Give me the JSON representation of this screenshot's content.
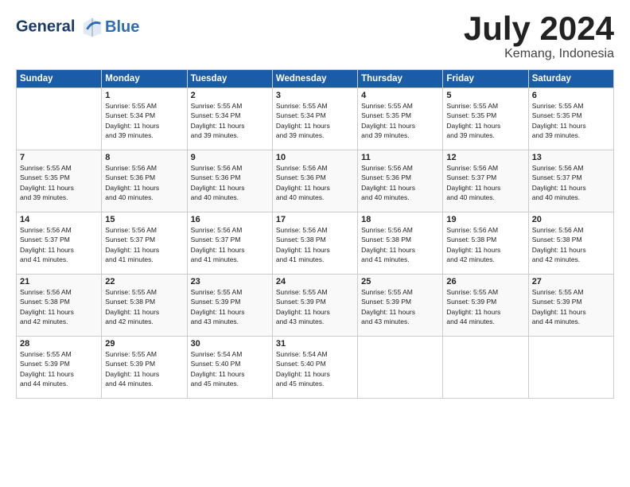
{
  "header": {
    "logo_line1": "General",
    "logo_line2": "Blue",
    "title": "July 2024",
    "subtitle": "Kemang, Indonesia"
  },
  "days_of_week": [
    "Sunday",
    "Monday",
    "Tuesday",
    "Wednesday",
    "Thursday",
    "Friday",
    "Saturday"
  ],
  "weeks": [
    [
      {
        "day": "",
        "info": ""
      },
      {
        "day": "1",
        "info": "Sunrise: 5:55 AM\nSunset: 5:34 PM\nDaylight: 11 hours\nand 39 minutes."
      },
      {
        "day": "2",
        "info": "Sunrise: 5:55 AM\nSunset: 5:34 PM\nDaylight: 11 hours\nand 39 minutes."
      },
      {
        "day": "3",
        "info": "Sunrise: 5:55 AM\nSunset: 5:34 PM\nDaylight: 11 hours\nand 39 minutes."
      },
      {
        "day": "4",
        "info": "Sunrise: 5:55 AM\nSunset: 5:35 PM\nDaylight: 11 hours\nand 39 minutes."
      },
      {
        "day": "5",
        "info": "Sunrise: 5:55 AM\nSunset: 5:35 PM\nDaylight: 11 hours\nand 39 minutes."
      },
      {
        "day": "6",
        "info": "Sunrise: 5:55 AM\nSunset: 5:35 PM\nDaylight: 11 hours\nand 39 minutes."
      }
    ],
    [
      {
        "day": "7",
        "info": "Sunrise: 5:55 AM\nSunset: 5:35 PM\nDaylight: 11 hours\nand 39 minutes."
      },
      {
        "day": "8",
        "info": "Sunrise: 5:56 AM\nSunset: 5:36 PM\nDaylight: 11 hours\nand 40 minutes."
      },
      {
        "day": "9",
        "info": "Sunrise: 5:56 AM\nSunset: 5:36 PM\nDaylight: 11 hours\nand 40 minutes."
      },
      {
        "day": "10",
        "info": "Sunrise: 5:56 AM\nSunset: 5:36 PM\nDaylight: 11 hours\nand 40 minutes."
      },
      {
        "day": "11",
        "info": "Sunrise: 5:56 AM\nSunset: 5:36 PM\nDaylight: 11 hours\nand 40 minutes."
      },
      {
        "day": "12",
        "info": "Sunrise: 5:56 AM\nSunset: 5:37 PM\nDaylight: 11 hours\nand 40 minutes."
      },
      {
        "day": "13",
        "info": "Sunrise: 5:56 AM\nSunset: 5:37 PM\nDaylight: 11 hours\nand 40 minutes."
      }
    ],
    [
      {
        "day": "14",
        "info": "Sunrise: 5:56 AM\nSunset: 5:37 PM\nDaylight: 11 hours\nand 41 minutes."
      },
      {
        "day": "15",
        "info": "Sunrise: 5:56 AM\nSunset: 5:37 PM\nDaylight: 11 hours\nand 41 minutes."
      },
      {
        "day": "16",
        "info": "Sunrise: 5:56 AM\nSunset: 5:37 PM\nDaylight: 11 hours\nand 41 minutes."
      },
      {
        "day": "17",
        "info": "Sunrise: 5:56 AM\nSunset: 5:38 PM\nDaylight: 11 hours\nand 41 minutes."
      },
      {
        "day": "18",
        "info": "Sunrise: 5:56 AM\nSunset: 5:38 PM\nDaylight: 11 hours\nand 41 minutes."
      },
      {
        "day": "19",
        "info": "Sunrise: 5:56 AM\nSunset: 5:38 PM\nDaylight: 11 hours\nand 42 minutes."
      },
      {
        "day": "20",
        "info": "Sunrise: 5:56 AM\nSunset: 5:38 PM\nDaylight: 11 hours\nand 42 minutes."
      }
    ],
    [
      {
        "day": "21",
        "info": "Sunrise: 5:56 AM\nSunset: 5:38 PM\nDaylight: 11 hours\nand 42 minutes."
      },
      {
        "day": "22",
        "info": "Sunrise: 5:55 AM\nSunset: 5:38 PM\nDaylight: 11 hours\nand 42 minutes."
      },
      {
        "day": "23",
        "info": "Sunrise: 5:55 AM\nSunset: 5:39 PM\nDaylight: 11 hours\nand 43 minutes."
      },
      {
        "day": "24",
        "info": "Sunrise: 5:55 AM\nSunset: 5:39 PM\nDaylight: 11 hours\nand 43 minutes."
      },
      {
        "day": "25",
        "info": "Sunrise: 5:55 AM\nSunset: 5:39 PM\nDaylight: 11 hours\nand 43 minutes."
      },
      {
        "day": "26",
        "info": "Sunrise: 5:55 AM\nSunset: 5:39 PM\nDaylight: 11 hours\nand 44 minutes."
      },
      {
        "day": "27",
        "info": "Sunrise: 5:55 AM\nSunset: 5:39 PM\nDaylight: 11 hours\nand 44 minutes."
      }
    ],
    [
      {
        "day": "28",
        "info": "Sunrise: 5:55 AM\nSunset: 5:39 PM\nDaylight: 11 hours\nand 44 minutes."
      },
      {
        "day": "29",
        "info": "Sunrise: 5:55 AM\nSunset: 5:39 PM\nDaylight: 11 hours\nand 44 minutes."
      },
      {
        "day": "30",
        "info": "Sunrise: 5:54 AM\nSunset: 5:40 PM\nDaylight: 11 hours\nand 45 minutes."
      },
      {
        "day": "31",
        "info": "Sunrise: 5:54 AM\nSunset: 5:40 PM\nDaylight: 11 hours\nand 45 minutes."
      },
      {
        "day": "",
        "info": ""
      },
      {
        "day": "",
        "info": ""
      },
      {
        "day": "",
        "info": ""
      }
    ]
  ]
}
